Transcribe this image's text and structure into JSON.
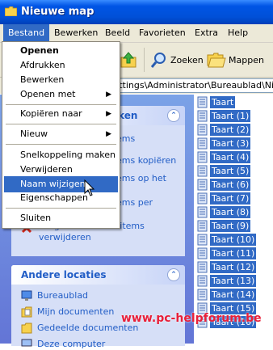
{
  "window": {
    "title": "Nieuwe map"
  },
  "menubar": {
    "items": [
      "Bestand",
      "Bewerken",
      "Beeld",
      "Favorieten",
      "Extra",
      "Help"
    ]
  },
  "toolbar": {
    "search_label": "Zoeken",
    "folders_label": "Mappen"
  },
  "address": {
    "path": "d Settings\\Administrator\\Bureaublad\\Nie"
  },
  "taskpane": {
    "file_tasks_title_partial": "aken",
    "file_tasks_fragments": [
      "ems",
      "ems kopiëren",
      "ems op het",
      "ems per"
    ],
    "delete_selected": "De geselecteerde items verwijderen",
    "other_places_title": "Andere locaties",
    "other_places": [
      "Bureaublad",
      "Mijn documenten",
      "Gedeelde documenten",
      "Deze computer"
    ]
  },
  "files": [
    "Taart",
    "Taart (1)",
    "Taart (2)",
    "Taart (3)",
    "Taart (4)",
    "Taart (5)",
    "Taart (6)",
    "Taart (7)",
    "Taart (8)",
    "Taart (9)",
    "Taart (10)",
    "Taart (11)",
    "Taart (12)",
    "Taart (13)",
    "Taart (14)",
    "Taart (15)",
    "Taart (16)"
  ],
  "menu": {
    "open": "Openen",
    "print": "Afdrukken",
    "edit": "Bewerken",
    "open_with": "Openen met",
    "copy_to": "Kopiëren naar",
    "new": "Nieuw",
    "shortcut": "Snelkoppeling maken",
    "delete": "Verwijderen",
    "rename": "Naam wijzigen",
    "properties": "Eigenschappen",
    "close": "Sluiten"
  },
  "watermark": "www.pc-helpforum.be",
  "colors": {
    "selection": "#316ac5",
    "titlebar": "#0055e5",
    "taskpane": "#6375d6"
  }
}
